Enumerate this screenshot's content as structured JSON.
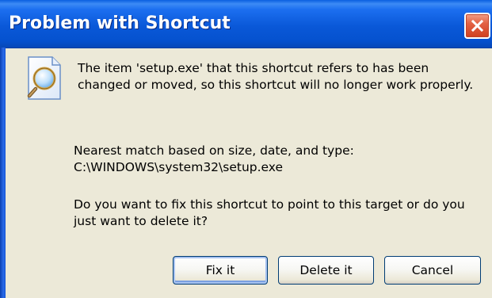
{
  "window": {
    "title": "Problem with Shortcut"
  },
  "icons": {
    "close": "close-icon",
    "dialog": "document-search-icon"
  },
  "message": {
    "lines": [
      "The item 'setup.exe' that this shortcut refers to has been",
      "changed or moved, so this shortcut will no longer work properly."
    ]
  },
  "match": {
    "lines": [
      "Nearest match based on size, date, and type:",
      "C:\\WINDOWS\\system32\\setup.exe"
    ]
  },
  "question": {
    "lines": [
      "Do you want to fix this shortcut to point to this target or do you",
      "just want to delete it?"
    ]
  },
  "buttons": {
    "fix": "Fix it",
    "delete": "Delete it",
    "cancel": "Cancel"
  },
  "colors": {
    "titlebar": "#0a58d8",
    "dialog_bg": "#ece9d8",
    "close_button": "#d0401f",
    "button_border": "#003c74"
  }
}
